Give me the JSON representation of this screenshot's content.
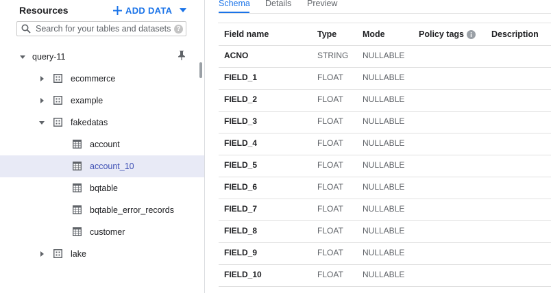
{
  "resources": {
    "title": "Resources",
    "add_data_label": "ADD DATA",
    "search_placeholder": "Search for your tables and datasets"
  },
  "tree": {
    "project": "query-11",
    "datasets": [
      {
        "name": "ecommerce",
        "expanded": false
      },
      {
        "name": "example",
        "expanded": false
      },
      {
        "name": "fakedatas",
        "expanded": true,
        "tables": [
          "account",
          "account_10",
          "bqtable",
          "bqtable_error_records",
          "customer"
        ]
      },
      {
        "name": "lake",
        "expanded": false
      }
    ],
    "selected_table": "account_10"
  },
  "tabs": [
    "Schema",
    "Details",
    "Preview"
  ],
  "active_tab": "Schema",
  "schema": {
    "columns": [
      "Field name",
      "Type",
      "Mode",
      "Policy tags",
      "Description"
    ],
    "rows": [
      {
        "name": "ACNO",
        "type": "STRING",
        "mode": "NULLABLE"
      },
      {
        "name": "FIELD_1",
        "type": "FLOAT",
        "mode": "NULLABLE"
      },
      {
        "name": "FIELD_2",
        "type": "FLOAT",
        "mode": "NULLABLE"
      },
      {
        "name": "FIELD_3",
        "type": "FLOAT",
        "mode": "NULLABLE"
      },
      {
        "name": "FIELD_4",
        "type": "FLOAT",
        "mode": "NULLABLE"
      },
      {
        "name": "FIELD_5",
        "type": "FLOAT",
        "mode": "NULLABLE"
      },
      {
        "name": "FIELD_6",
        "type": "FLOAT",
        "mode": "NULLABLE"
      },
      {
        "name": "FIELD_7",
        "type": "FLOAT",
        "mode": "NULLABLE"
      },
      {
        "name": "FIELD_8",
        "type": "FLOAT",
        "mode": "NULLABLE"
      },
      {
        "name": "FIELD_9",
        "type": "FLOAT",
        "mode": "NULLABLE"
      },
      {
        "name": "FIELD_10",
        "type": "FLOAT",
        "mode": "NULLABLE"
      }
    ]
  },
  "colors": {
    "accent": "#1a73e8",
    "selected_bg": "#e8eaf6",
    "selected_text": "#3f51b5",
    "border": "#e0e0e0"
  },
  "icons": {
    "add": "plus-icon",
    "dropdown": "caret-down-icon",
    "search": "search-icon",
    "help": "help-icon",
    "pin": "pin-icon",
    "dataset": "dataset-icon",
    "table": "table-icon",
    "info": "info-icon"
  }
}
